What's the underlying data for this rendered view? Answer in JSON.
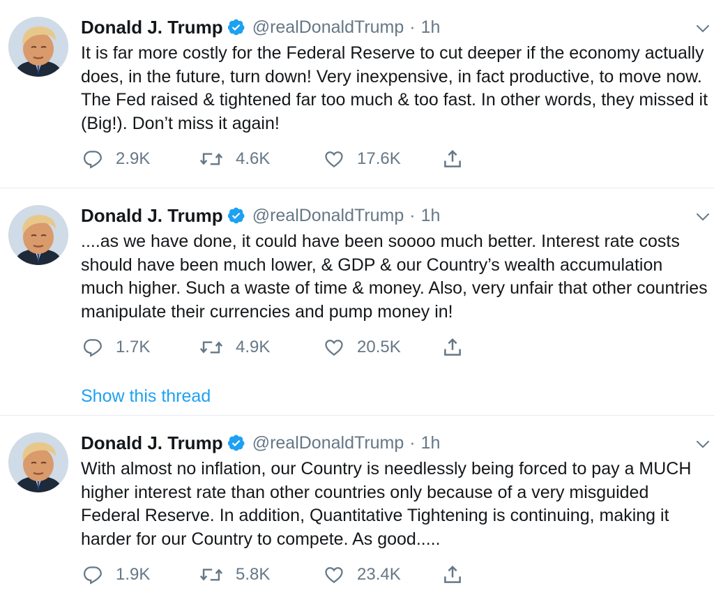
{
  "tweets": [
    {
      "author": {
        "name": "Donald J. Trump",
        "handle": "@realDonaldTrump"
      },
      "separator": "·",
      "time": "1h",
      "text": "It is far more costly for the Federal Reserve to cut deeper if the economy actually does, in the future, turn down! Very inexpensive, in fact productive, to move now. The Fed raised & tightened far too much & too fast. In other words, they missed it (Big!). Don’t miss it again!",
      "stats": {
        "replies": "2.9K",
        "retweets": "4.6K",
        "likes": "17.6K"
      }
    },
    {
      "author": {
        "name": "Donald J. Trump",
        "handle": "@realDonaldTrump"
      },
      "separator": "·",
      "time": "1h",
      "text": "....as we have done, it could have been soooo much better. Interest rate costs should have been much lower, & GDP & our Country’s wealth accumulation much higher. Such a waste of time & money. Also, very unfair that other countries manipulate their currencies and pump money in!",
      "stats": {
        "replies": "1.7K",
        "retweets": "4.9K",
        "likes": "20.5K"
      },
      "thread_link": "Show this thread"
    },
    {
      "author": {
        "name": "Donald J. Trump",
        "handle": "@realDonaldTrump"
      },
      "separator": "·",
      "time": "1h",
      "text": "With almost no inflation, our Country is needlessly being forced to pay a MUCH higher interest rate than other countries only because of a very misguided Federal Reserve. In addition, Quantitative Tightening is continuing, making it harder for our Country to compete. As good.....",
      "stats": {
        "replies": "1.9K",
        "retweets": "5.8K",
        "likes": "23.4K"
      }
    }
  ],
  "icons": {
    "verified": "verified-badge-icon",
    "caret": "chevron-down-icon",
    "reply": "reply-icon",
    "retweet": "retweet-icon",
    "like": "heart-icon",
    "share": "share-icon"
  },
  "colors": {
    "text": "#14171a",
    "secondary": "#657786",
    "link": "#1da1f2",
    "divider": "#e6ecf0"
  }
}
